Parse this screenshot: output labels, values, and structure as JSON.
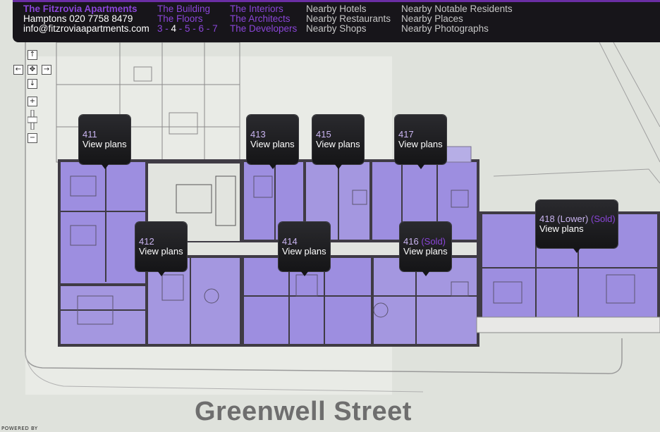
{
  "header": {
    "brand": "The Fitzrovia Apartments",
    "phone": "Hamptons 020 7758 8479",
    "email": "info@fitzroviaapartments.com",
    "building_link": "The Building",
    "floors_link": "The Floors",
    "floors": [
      "3",
      "4",
      "5",
      "6",
      "7"
    ],
    "current_floor": "4",
    "interiors_link": "The Interiors",
    "architects_link": "The Architects",
    "developers_link": "The Developers",
    "nearby_hotels": "Nearby Hotels",
    "nearby_restaurants": "Nearby Restaurants",
    "nearby_shops": "Nearby Shops",
    "nearby_residents": "Nearby Notable Residents",
    "nearby_places": "Nearby Places",
    "nearby_photographs": "Nearby Photographs"
  },
  "controls": {
    "pan_up_icon": "arrow-up-icon",
    "pan_left_icon": "arrow-left-icon",
    "pan_right_icon": "arrow-right-icon",
    "pan_down_icon": "arrow-down-icon",
    "center_icon": "center-icon",
    "zoom_in_icon": "plus-icon",
    "zoom_out_icon": "minus-icon"
  },
  "apartments": {
    "a411": {
      "number": "411",
      "status": "",
      "link": "View plans"
    },
    "a412": {
      "number": "412",
      "status": "",
      "link": "View plans"
    },
    "a413": {
      "number": "413",
      "status": "",
      "link": "View plans"
    },
    "a414": {
      "number": "414",
      "status": "",
      "link": "View plans"
    },
    "a415": {
      "number": "415",
      "status": "",
      "link": "View plans"
    },
    "a416": {
      "number": "416",
      "status": "(Sold)",
      "link": "View plans"
    },
    "a417": {
      "number": "417",
      "status": "",
      "link": "View plans"
    },
    "a418": {
      "number": "418 (Lower)",
      "status": "(Sold)",
      "link": "View plans"
    }
  },
  "map": {
    "street_label": "Greenwell Street",
    "powered_by": "POWERED BY"
  },
  "colors": {
    "accent": "#8a45d8",
    "unit_fill": "#9d8ee0",
    "wall": "#3d3a40",
    "background": "#dfe2dc"
  }
}
